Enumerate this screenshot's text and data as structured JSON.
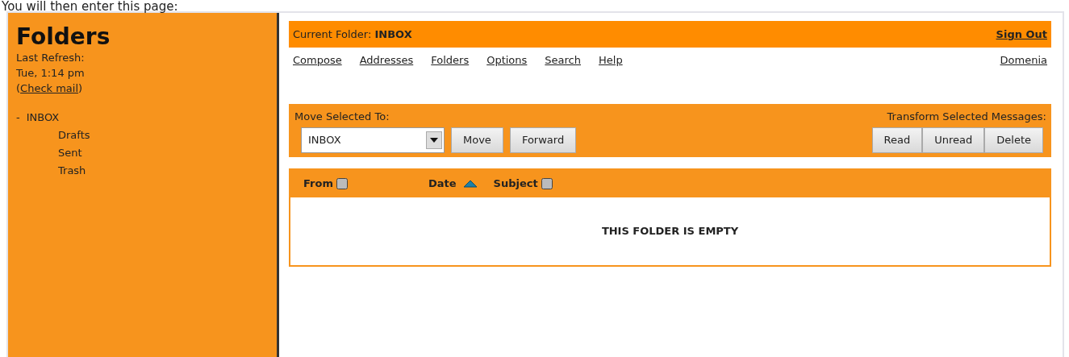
{
  "caption": "You will then enter this page:",
  "sidebar": {
    "title": "Folders",
    "refresh_label": "Last Refresh:",
    "refresh_time": "Tue, 1:14 pm",
    "check_mail_open": "(",
    "check_mail": "Check mail",
    "check_mail_close": ")",
    "folders": [
      {
        "name": "INBOX",
        "marker": "-",
        "children": [
          {
            "name": "Drafts"
          },
          {
            "name": "Sent"
          },
          {
            "name": "Trash"
          }
        ]
      }
    ]
  },
  "header": {
    "label": "Current Folder:",
    "folder": "INBOX",
    "sign_out": "Sign Out"
  },
  "nav": {
    "links": [
      "Compose",
      "Addresses",
      "Folders",
      "Options",
      "Search",
      "Help"
    ],
    "right_link": "Domenia"
  },
  "toolbar": {
    "move_label": "Move Selected To:",
    "move_select": "INBOX",
    "move_buttons": [
      "Move",
      "Forward"
    ],
    "transform_label": "Transform Selected Messages:",
    "transform_buttons": [
      "Read",
      "Unread",
      "Delete"
    ]
  },
  "message_list": {
    "columns": [
      {
        "label": "From",
        "sorted": false
      },
      {
        "label": "Date",
        "sorted": true
      },
      {
        "label": "Subject",
        "sorted": false
      }
    ],
    "empty_text": "THIS FOLDER IS EMPTY"
  }
}
